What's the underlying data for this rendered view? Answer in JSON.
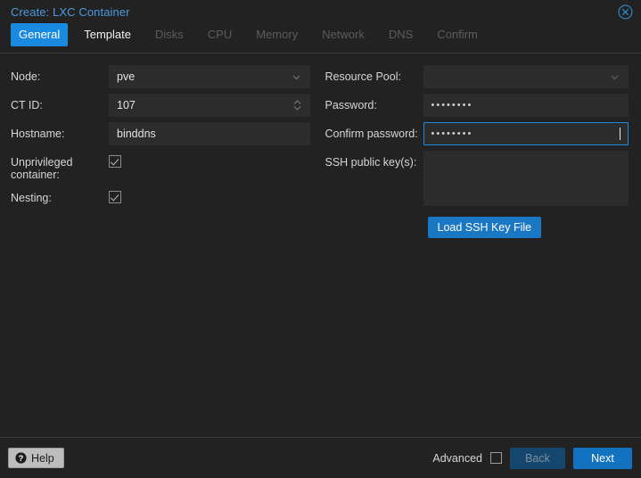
{
  "window": {
    "title": "Create: LXC Container",
    "close_icon": "close-circle-icon"
  },
  "tabs": [
    {
      "label": "General",
      "state": "active"
    },
    {
      "label": "Template",
      "state": "enabled"
    },
    {
      "label": "Disks",
      "state": "disabled"
    },
    {
      "label": "CPU",
      "state": "disabled"
    },
    {
      "label": "Memory",
      "state": "disabled"
    },
    {
      "label": "Network",
      "state": "disabled"
    },
    {
      "label": "DNS",
      "state": "disabled"
    },
    {
      "label": "Confirm",
      "state": "disabled"
    }
  ],
  "form": {
    "left": {
      "node": {
        "label": "Node:",
        "value": "pve",
        "placeholder": ""
      },
      "ctid": {
        "label": "CT ID:",
        "value": "107",
        "placeholder": ""
      },
      "hostname": {
        "label": "Hostname:",
        "value": "binddns",
        "placeholder": ""
      },
      "unprivileged": {
        "label": "Unprivileged container:",
        "checked": "true"
      },
      "nesting": {
        "label": "Nesting:",
        "checked": "true"
      }
    },
    "right": {
      "resource_pool": {
        "label": "Resource Pool:",
        "value": "",
        "placeholder": ""
      },
      "password": {
        "label": "Password:",
        "value": "••••••••",
        "placeholder": ""
      },
      "confirm_password": {
        "label": "Confirm password:",
        "value": "••••••••",
        "placeholder": "",
        "focused": "true"
      },
      "ssh_keys": {
        "label": "SSH public key(s):",
        "value": "",
        "placeholder": ""
      },
      "load_ssh_button": "Load SSH Key File"
    }
  },
  "footer": {
    "help_label": "Help",
    "help_icon": "question-circle-icon",
    "advanced_label": "Advanced",
    "advanced_checked": "false",
    "back_label": "Back",
    "next_label": "Next"
  },
  "colors": {
    "accent_blue": "#1a8ae0",
    "primary_button": "#1272c0",
    "disabled_button": "#14466e",
    "title_blue": "#4d9ae0",
    "dialog_bg": "#222222",
    "input_bg": "#2c2c2c"
  }
}
